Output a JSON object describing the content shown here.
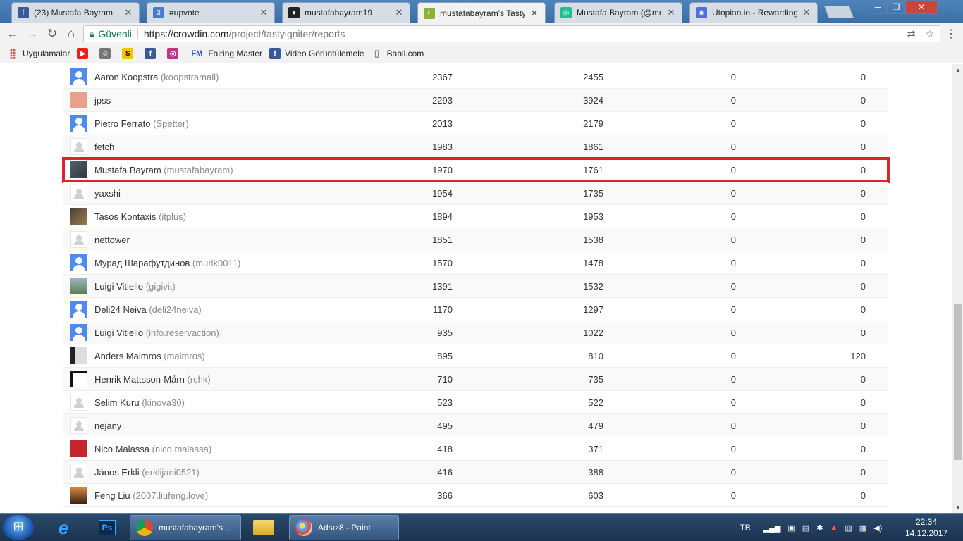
{
  "tabs": [
    {
      "title": "(23) Mustafa Bayram",
      "icon": "facebook-icon",
      "color": "#3b5998",
      "glyph": "f"
    },
    {
      "title": "#upvote",
      "icon": "upvote-icon",
      "color": "#4a7bd0",
      "glyph": "3"
    },
    {
      "title": "mustafabayram19",
      "icon": "github-icon",
      "color": "#222222",
      "glyph": "●"
    },
    {
      "title": "mustafabayram's TastyIg",
      "icon": "crowdin-icon",
      "color": "#8bb33a",
      "glyph": "◐"
    },
    {
      "title": "Mustafa Bayram (@must",
      "icon": "steemit-icon",
      "color": "#1fbf8f",
      "glyph": "◎"
    },
    {
      "title": "Utopian.io - Rewarding C",
      "icon": "utopian-icon",
      "color": "#4f6fe0",
      "glyph": "◉"
    }
  ],
  "toolbar": {
    "secure_label": "Güvenli",
    "url_host": "https://crowdin.com",
    "url_path": "/project/tastyigniter/reports"
  },
  "bookmarks": [
    {
      "label": "Uygulamalar",
      "icon": "apps-icon",
      "color": "#e8453c",
      "glyph": "⣿"
    },
    {
      "label": "",
      "icon": "youtube-icon",
      "color": "#e62117",
      "glyph": "▶"
    },
    {
      "label": "",
      "icon": "user-avatar-icon",
      "color": "#777777",
      "glyph": "☺"
    },
    {
      "label": "",
      "icon": "s-icon",
      "color": "#f5c400",
      "glyph": "S"
    },
    {
      "label": "",
      "icon": "facebook-icon",
      "color": "#3b5998",
      "glyph": "f"
    },
    {
      "label": "",
      "icon": "instagram-icon",
      "color": "#c13584",
      "glyph": "◎"
    },
    {
      "label": "Fairing Master",
      "icon": "fm-icon",
      "color": "#1c4fcf",
      "glyph": "FM"
    },
    {
      "label": "Video Görüntülemele",
      "icon": "facebook-icon",
      "color": "#3b5998",
      "glyph": "f"
    },
    {
      "label": "Babil.com",
      "icon": "page-icon",
      "color": "#888888",
      "glyph": "▯"
    }
  ],
  "members": [
    {
      "name": "Aaron Koopstra",
      "login": "(koopstramail)",
      "avatar": "blue",
      "v1": "2367",
      "v2": "2455",
      "v3": "0",
      "v4": "0"
    },
    {
      "name": "jpss",
      "login": "",
      "avatar": "pink",
      "v1": "2293",
      "v2": "3924",
      "v3": "0",
      "v4": "0"
    },
    {
      "name": "Pietro Ferrato",
      "login": "(Spetter)",
      "avatar": "blue",
      "v1": "2013",
      "v2": "2179",
      "v3": "0",
      "v4": "0"
    },
    {
      "name": "fetch",
      "login": "",
      "avatar": "grey",
      "v1": "1983",
      "v2": "1861",
      "v3": "0",
      "v4": "0"
    },
    {
      "name": "Mustafa Bayram",
      "login": "(mustafabayram)",
      "avatar": "photo",
      "v1": "1970",
      "v2": "1761",
      "v3": "0",
      "v4": "0"
    },
    {
      "name": "yaxshi",
      "login": "",
      "avatar": "grey",
      "v1": "1954",
      "v2": "1735",
      "v3": "0",
      "v4": "0"
    },
    {
      "name": "Tasos Kontaxis",
      "login": "(itplus)",
      "avatar": "dark",
      "v1": "1894",
      "v2": "1953",
      "v3": "0",
      "v4": "0"
    },
    {
      "name": "nettower",
      "login": "",
      "avatar": "grey",
      "v1": "1851",
      "v2": "1538",
      "v3": "0",
      "v4": "0"
    },
    {
      "name": "Мурад Шарафутдинов",
      "login": "(murik0011)",
      "avatar": "blue",
      "v1": "1570",
      "v2": "1478",
      "v3": "0",
      "v4": "0"
    },
    {
      "name": "Luigi Vitiello",
      "login": "(gigivit)",
      "avatar": "sky",
      "v1": "1391",
      "v2": "1532",
      "v3": "0",
      "v4": "0"
    },
    {
      "name": "Deli24 Neiva",
      "login": "(deli24neiva)",
      "avatar": "blue",
      "v1": "1170",
      "v2": "1297",
      "v3": "0",
      "v4": "0"
    },
    {
      "name": "Luigi Vitiello",
      "login": "(info.reservaction)",
      "avatar": "blue",
      "v1": "935",
      "v2": "1022",
      "v3": "0",
      "v4": "0"
    },
    {
      "name": "Anders Malmros",
      "login": "(malmros)",
      "avatar": "bw",
      "v1": "895",
      "v2": "810",
      "v3": "0",
      "v4": "120"
    },
    {
      "name": "Henrik Mattsson-Mårn",
      "login": "(rchk)",
      "avatar": "frame",
      "v1": "710",
      "v2": "735",
      "v3": "0",
      "v4": "0"
    },
    {
      "name": "Selim Kuru",
      "login": "(kinova30)",
      "avatar": "grey",
      "v1": "523",
      "v2": "522",
      "v3": "0",
      "v4": "0"
    },
    {
      "name": "nejany",
      "login": "",
      "avatar": "grey",
      "v1": "495",
      "v2": "479",
      "v3": "0",
      "v4": "0"
    },
    {
      "name": "Nico Malassa",
      "login": "(nico.malassa)",
      "avatar": "red",
      "v1": "418",
      "v2": "371",
      "v3": "0",
      "v4": "0"
    },
    {
      "name": "János Erkli",
      "login": "(erklijani0521)",
      "avatar": "grey",
      "v1": "416",
      "v2": "388",
      "v3": "0",
      "v4": "0"
    },
    {
      "name": "Feng Liu",
      "login": "(2007.liufeng.love)",
      "avatar": "sunset",
      "v1": "366",
      "v2": "603",
      "v3": "0",
      "v4": "0"
    }
  ],
  "highlight_name": "Mustafa Bayram",
  "taskbar": {
    "tasks": [
      {
        "label": "mustafabayram's ...",
        "icon": "chrome-icon"
      },
      {
        "label": "Adsız8 - Paint",
        "icon": "paint-icon"
      }
    ],
    "language": "TR",
    "time": "22:34",
    "date": "14.12.2017"
  },
  "colors": {
    "highlight_border": "#e0232b",
    "secure_green": "#0b8043",
    "taskbar": "#1b3350"
  }
}
